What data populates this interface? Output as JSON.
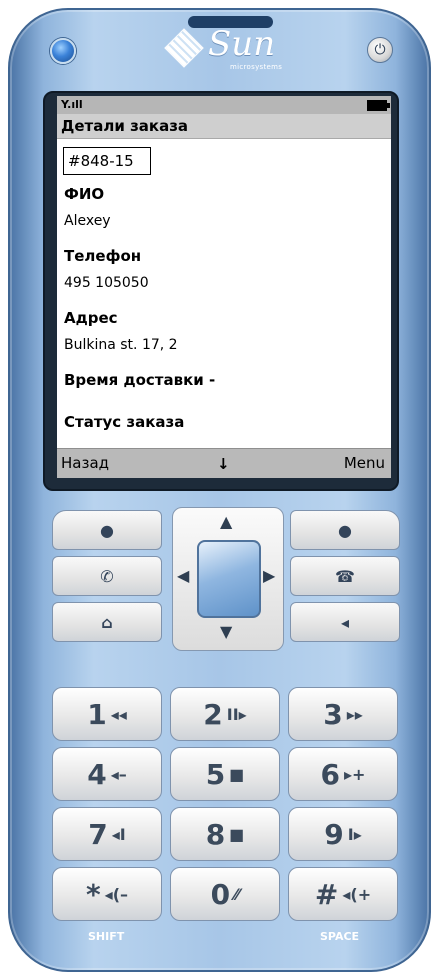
{
  "device": {
    "brand": "Sun",
    "brand_sub": "microsystems",
    "power_symbol": "⏻"
  },
  "screen": {
    "title": "Детали заказа",
    "order_number": "#848-15",
    "fields": [
      {
        "label": "ФИО",
        "value": "Alexey"
      },
      {
        "label": "Телефон",
        "value": "495 105050"
      },
      {
        "label": "Адрес",
        "value": "Bulkina st. 17, 2"
      },
      {
        "label": "Время доставки  -",
        "value": ""
      },
      {
        "label": "Статус заказа",
        "value": ""
      }
    ],
    "softkeys": {
      "left": "Назад",
      "middle": "↓",
      "right": "Menu"
    }
  },
  "keys": {
    "select_left": "●",
    "select_right": "●",
    "call": "✆",
    "end": "☎",
    "home": "⌂",
    "back": "◂",
    "dpad_up": "▲",
    "dpad_down": "▼",
    "dpad_left": "◀",
    "dpad_right": "▶"
  },
  "keypad": [
    {
      "digit": "1",
      "sym": "◂◂"
    },
    {
      "digit": "2",
      "sym": "II▸"
    },
    {
      "digit": "3",
      "sym": "▸▸"
    },
    {
      "digit": "4",
      "sym": "◂–"
    },
    {
      "digit": "5",
      "sym": "■"
    },
    {
      "digit": "6",
      "sym": "▸+"
    },
    {
      "digit": "7",
      "sym": "◂I"
    },
    {
      "digit": "8",
      "sym": "■"
    },
    {
      "digit": "9",
      "sym": "I▸"
    },
    {
      "digit": "*",
      "sym": "◂(–"
    },
    {
      "digit": "0",
      "sym": "⁄⁄"
    },
    {
      "digit": "#",
      "sym": "◂(+"
    }
  ],
  "bottom_labels": {
    "left": "SHIFT",
    "right": "SPACE"
  },
  "colors": {
    "body": "#a7c6e7",
    "screen_bg": "#ffffff",
    "status_bar": "#b6b6b6"
  }
}
